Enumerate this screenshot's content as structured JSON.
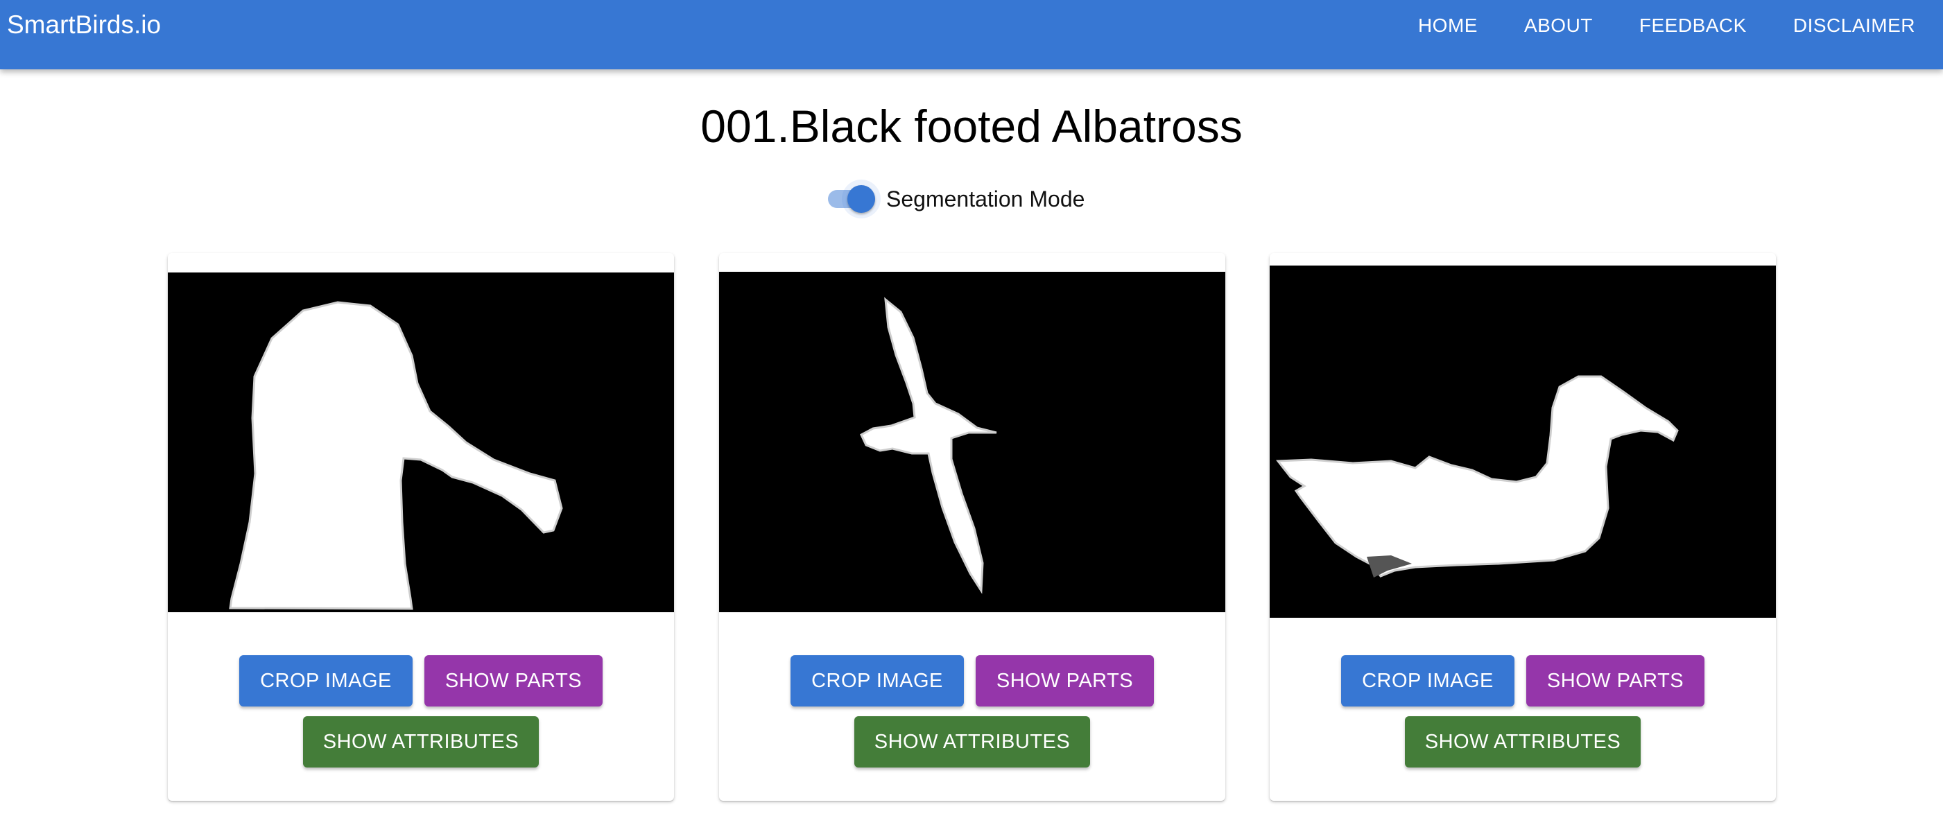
{
  "header": {
    "brand": "SmartBirds.io",
    "nav": [
      "HOME",
      "ABOUT",
      "FEEDBACK",
      "DISCLAIMER"
    ]
  },
  "title": "001.Black footed Albatross",
  "segmentation_toggle": {
    "label": "Segmentation Mode",
    "checked": true
  },
  "cards": [
    {
      "crop_label": "CROP IMAGE",
      "parts_label": "SHOW PARTS",
      "attributes_label": "SHOW ATTRIBUTES"
    },
    {
      "crop_label": "CROP IMAGE",
      "parts_label": "SHOW PARTS",
      "attributes_label": "SHOW ATTRIBUTES"
    },
    {
      "crop_label": "CROP IMAGE",
      "parts_label": "SHOW PARTS",
      "attributes_label": "SHOW ATTRIBUTES"
    }
  ],
  "colors": {
    "app_bar": "#3777d3",
    "crop_button": "#3777d3",
    "parts_button": "#9536aa",
    "attributes_button": "#447d39"
  }
}
